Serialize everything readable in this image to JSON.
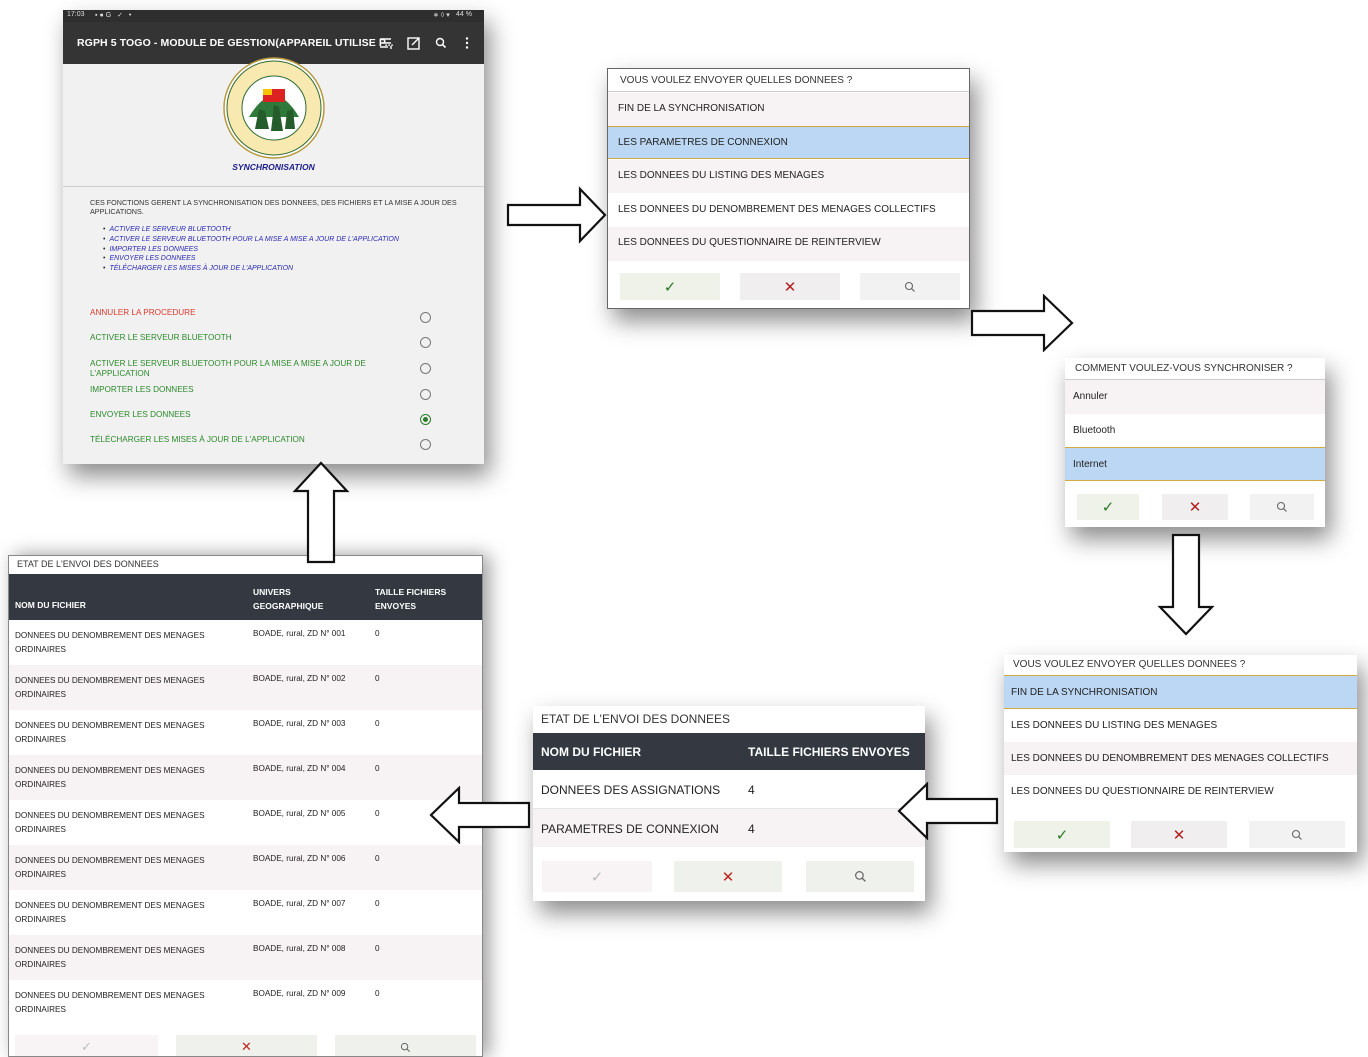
{
  "colors": {
    "accent_green": "#2b8a2b",
    "cancel_red": "#e0392e",
    "selected_row": "#bcd7f3",
    "header_dark": "#333841"
  },
  "main_screen": {
    "statusbar": {
      "time": "17:03",
      "battery": "44 %"
    },
    "appbar": {
      "title": "RGPH 5 TOGO - MODULE DE GESTION(APPAREIL UTILISE P...",
      "icons": [
        "list-icon",
        "edit-icon",
        "search-icon",
        "more-icon"
      ]
    },
    "logo_text": "5e RECENSEMENT GENERAL DE LA POPULATION ET DE L'HABITAT AU TOGO",
    "section_title": "SYNCHRONISATION",
    "description": "CES FONCTIONS GERENT LA SYNCHRONISATION DES DONNEES, DES FICHIERS ET LA MISE A JOUR DES APPLICATIONS.",
    "bullets": [
      "ACTIVER LE SERVEUR BLUETOOTH",
      "ACTIVER LE SERVEUR BLUETOOTH POUR LA MISE A MISE A JOUR DE L'APPLICATION",
      "IMPORTER LES DONNEES",
      "ENVOYER LES DONNEES",
      "TÉLÉCHARGER LES MISES À JOUR DE L'APPLICATION"
    ],
    "options": [
      {
        "label": "ANNULER LA PROCEDURE",
        "selected": false
      },
      {
        "label": "ACTIVER LE SERVEUR BLUETOOTH",
        "selected": false
      },
      {
        "label": "ACTIVER LE SERVEUR BLUETOOTH POUR LA MISE A MISE A JOUR DE L'APPLICATION",
        "selected": false
      },
      {
        "label": "IMPORTER LES DONNEES",
        "selected": false
      },
      {
        "label": "ENVOYER LES DONNEES",
        "selected": true
      },
      {
        "label": "TÉLÉCHARGER LES MISES À JOUR DE L'APPLICATION",
        "selected": false
      }
    ]
  },
  "dialog_send_1": {
    "title": "VOUS VOULEZ ENVOYER QUELLES DONNEES ?",
    "items": [
      "FIN DE LA SYNCHRONISATION",
      "LES PARAMETRES DE CONNEXION",
      "LES DONNEES DU LISTING DES MENAGES",
      "LES DONNEES DU DENOMBREMENT DES MENAGES COLLECTIFS",
      "LES DONNEES DU QUESTIONNAIRE DE REINTERVIEW"
    ],
    "selected_index": 1,
    "buttons": {
      "ok": "✓",
      "cancel": "✕",
      "search": "search-icon"
    }
  },
  "dialog_method": {
    "title": "COMMENT VOULEZ-VOUS SYNCHRONISER ?",
    "items": [
      "Annuler",
      "Bluetooth",
      "Internet"
    ],
    "selected_index": 2,
    "buttons": {
      "ok": "✓",
      "cancel": "✕",
      "search": "search-icon"
    }
  },
  "dialog_send_2": {
    "title": "VOUS VOULEZ ENVOYER QUELLES DONNEES ?",
    "items": [
      "FIN DE LA SYNCHRONISATION",
      "LES DONNEES DU LISTING DES MENAGES",
      "LES DONNEES DU DENOMBREMENT DES MENAGES COLLECTIFS",
      "LES DONNEES DU QUESTIONNAIRE DE REINTERVIEW"
    ],
    "selected_index": 0,
    "buttons": {
      "ok": "✓",
      "cancel": "✕",
      "search": "search-icon"
    }
  },
  "status_small": {
    "title": "ETAT DE L'ENVOI DES DONNEES",
    "columns": [
      "NOM DU FICHIER",
      "TAILLE FICHIERS ENVOYES"
    ],
    "rows": [
      [
        "DONNEES DES ASSIGNATIONS",
        "4"
      ],
      [
        "PARAMETRES DE CONNEXION",
        "4"
      ]
    ],
    "buttons": {
      "ok": "✓",
      "cancel": "✕",
      "search": "search-icon"
    }
  },
  "status_large": {
    "title": "ETAT DE L'ENVOI DES DONNEES",
    "columns": [
      "NOM DU FICHIER",
      "UNIVERS GEOGRAPHIQUE",
      "TAILLE FICHIERS ENVOYES"
    ],
    "rows": [
      [
        "DONNEES DU DENOMBREMENT DES MENAGES ORDINAIRES",
        "BOADE, rural, ZD N° 001",
        "0"
      ],
      [
        "DONNEES DU DENOMBREMENT DES MENAGES ORDINAIRES",
        "BOADE, rural, ZD N° 002",
        "0"
      ],
      [
        "DONNEES DU DENOMBREMENT DES MENAGES ORDINAIRES",
        "BOADE, rural, ZD N° 003",
        "0"
      ],
      [
        "DONNEES DU DENOMBREMENT DES MENAGES ORDINAIRES",
        "BOADE, rural, ZD N° 004",
        "0"
      ],
      [
        "DONNEES DU DENOMBREMENT DES MENAGES ORDINAIRES",
        "BOADE, rural, ZD N° 005",
        "0"
      ],
      [
        "DONNEES DU DENOMBREMENT DES MENAGES ORDINAIRES",
        "BOADE, rural, ZD N° 006",
        "0"
      ],
      [
        "DONNEES DU DENOMBREMENT DES MENAGES ORDINAIRES",
        "BOADE, rural, ZD N° 007",
        "0"
      ],
      [
        "DONNEES DU DENOMBREMENT DES MENAGES ORDINAIRES",
        "BOADE, rural, ZD N° 008",
        "0"
      ],
      [
        "DONNEES DU DENOMBREMENT DES MENAGES ORDINAIRES",
        "BOADE, rural, ZD N° 009",
        "0"
      ]
    ],
    "buttons": {
      "ok": "✓",
      "cancel": "✕",
      "search": "search-icon"
    }
  },
  "flow_arrows": [
    "arrow-right",
    "arrow-right",
    "arrow-down",
    "arrow-left",
    "arrow-left",
    "arrow-up"
  ]
}
